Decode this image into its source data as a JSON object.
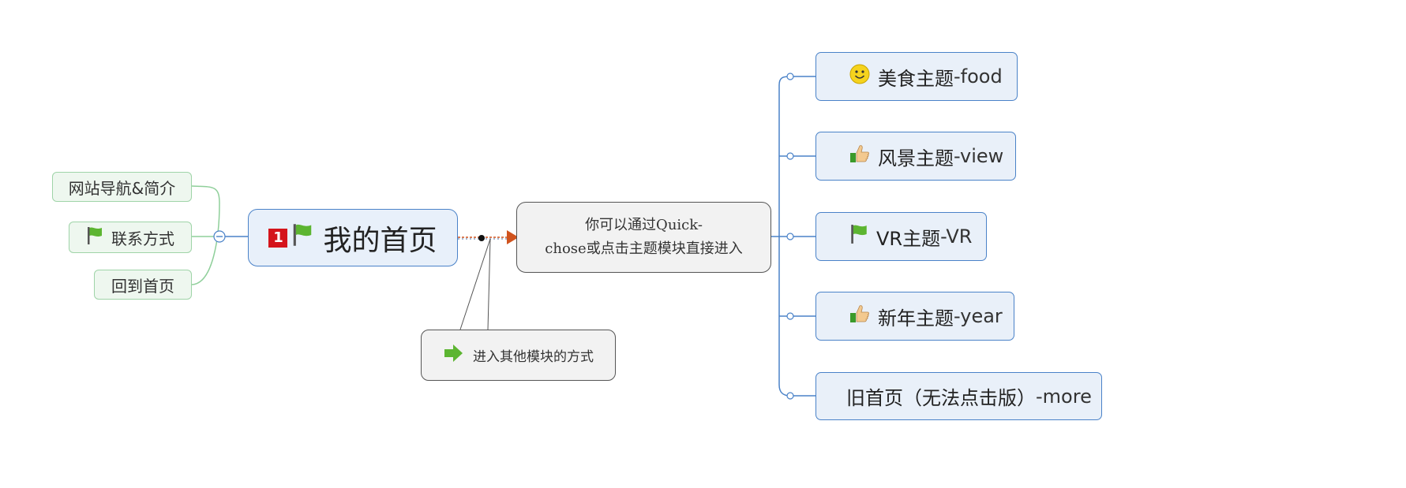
{
  "central": {
    "label": "我的首页",
    "priority_badge": "1",
    "icons": [
      "priority-1-icon",
      "green-flag-icon"
    ]
  },
  "left_branch": {
    "collapse_symbol": "−",
    "items": [
      {
        "label": "网站导航&简介",
        "icon": null
      },
      {
        "label": "联系方式",
        "icon": "green-flag-icon"
      },
      {
        "label": "回到首页",
        "icon": null
      }
    ]
  },
  "callout": {
    "line1": "你可以通过Quick-",
    "line2": "chose或点击主题模块直接进入"
  },
  "note": {
    "label": "进入其他模块的方式",
    "icon": "green-arrow-right-icon"
  },
  "right_branch": {
    "items": [
      {
        "label": "美食主题",
        "suffix": "-food",
        "icon": "smiley-icon"
      },
      {
        "label": "风景主题",
        "suffix": "-view",
        "icon": "thumbs-up-icon"
      },
      {
        "label": "VR主题",
        "suffix": "-VR",
        "icon": "green-flag-icon"
      },
      {
        "label": "新年主题",
        "suffix": "-year",
        "icon": "thumbs-up-icon"
      },
      {
        "label": "旧首页（无法点击版）",
        "suffix": "-more",
        "icon": null
      }
    ]
  },
  "colors": {
    "node_fill": "#e9f0f9",
    "node_border": "#4a82c8",
    "left_fill": "#eef7ef",
    "left_border": "#9fd4a8",
    "callout_fill": "#f2f2f2",
    "arrow": "#d0531e",
    "flag": "#5cb531",
    "badge": "#d4141b"
  }
}
